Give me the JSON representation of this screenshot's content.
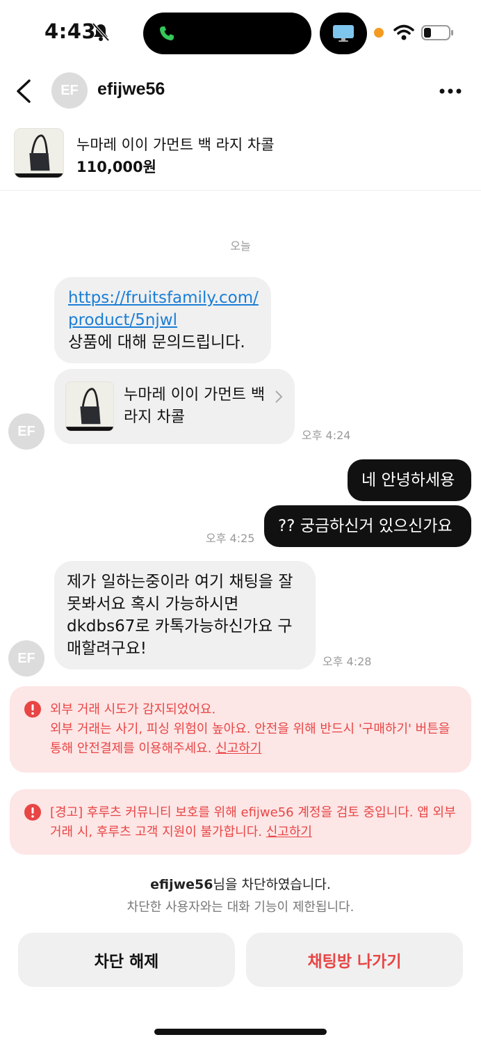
{
  "status_bar": {
    "time": "4:43"
  },
  "header": {
    "avatar_initials": "EF",
    "username": "efijwe56"
  },
  "product": {
    "title": "누마레 이이 가먼트 백 라지 차콜",
    "price": "110,000원"
  },
  "chat": {
    "date_separator": "오늘",
    "messages": [
      {
        "link_line1": "https://fruitsfamily.com/",
        "link_line2": "product/5njwl",
        "text": "상품에 대해 문의드립니다."
      },
      {
        "card_title": "누마레 이이 가먼트 백 라지 차콜",
        "time": "오후 4:24"
      },
      {
        "text": "네 안녕하세용"
      },
      {
        "text": "?? 궁금하신거 있으신가요",
        "time": "오후 4:25"
      },
      {
        "text": "제가 일하는중이라 여기 채팅을 잘 못봐서요 혹시 가능하시면 dkdbs67로 카톡가능하신가요 구매할려구요!",
        "time": "오후 4:28"
      }
    ]
  },
  "warnings": [
    {
      "title": "외부 거래 시도가 감지되었어요.",
      "body": "외부 거래는 사기, 피싱 위험이 높아요. 안전을 위해 반드시 '구매하기' 버튼을 통해 안전결제를 이용해주세요.",
      "link": "신고하기"
    },
    {
      "body": "[경고] 후루츠 커뮤니티 보호를 위해 efijwe56 계정을 검토 중입니다. 앱 외부 거래 시, 후루츠 고객 지원이 불가합니다.",
      "link": "신고하기"
    }
  ],
  "blocked": {
    "username": "efijwe56",
    "suffix": "님을 차단하였습니다.",
    "note": "차단한 사용자와는 대화 기능이 제한됩니다."
  },
  "buttons": {
    "unblock": "차단 해제",
    "leave": "채팅방 나가기"
  },
  "colors": {
    "warning": "#e84545",
    "warning_bg": "#fde6e6",
    "link": "#1a7ed6"
  }
}
